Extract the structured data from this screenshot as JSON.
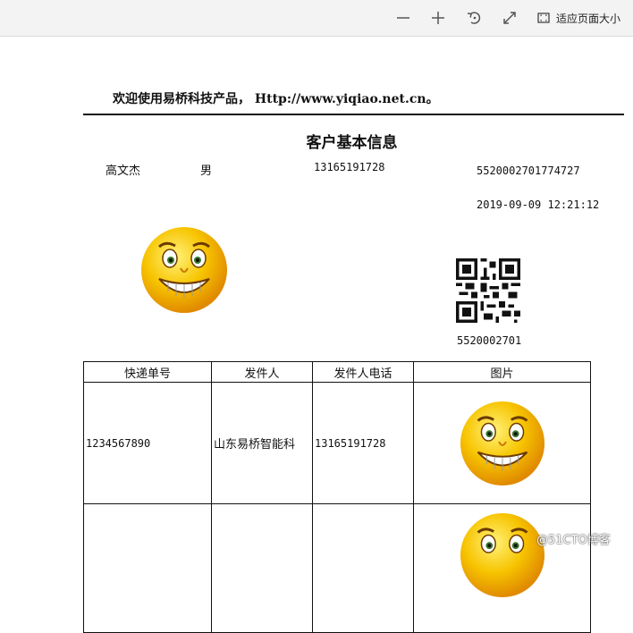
{
  "toolbar": {
    "zoom_out_icon": "minus-icon",
    "zoom_in_icon": "plus-icon",
    "rotate_icon": "rotate-icon",
    "fullscreen_icon": "expand-icon",
    "fit_label": "适应页面大小"
  },
  "document": {
    "welcome": "欢迎使用易桥科技产品， Http://www.yiqiao.net.cn。",
    "title": "客户基本信息",
    "customer": {
      "name": "高文杰",
      "gender": "男",
      "phone": "13165191728",
      "id": "5520002701774727",
      "datetime": "2019-09-09 12:21:12"
    },
    "qr_label": "5520002701",
    "table": {
      "headers": [
        "快递单号",
        "发件人",
        "发件人电话",
        "图片"
      ],
      "rows": [
        {
          "tracking": "1234567890",
          "sender": "山东易桥智能科",
          "phone": "13165191728"
        },
        {
          "tracking": "",
          "sender": "",
          "phone": ""
        }
      ]
    }
  },
  "watermark": "@51CTO博客",
  "colors": {
    "smiley_yellow": "#f5c400",
    "toolbar_bg": "#f3f3f3"
  }
}
